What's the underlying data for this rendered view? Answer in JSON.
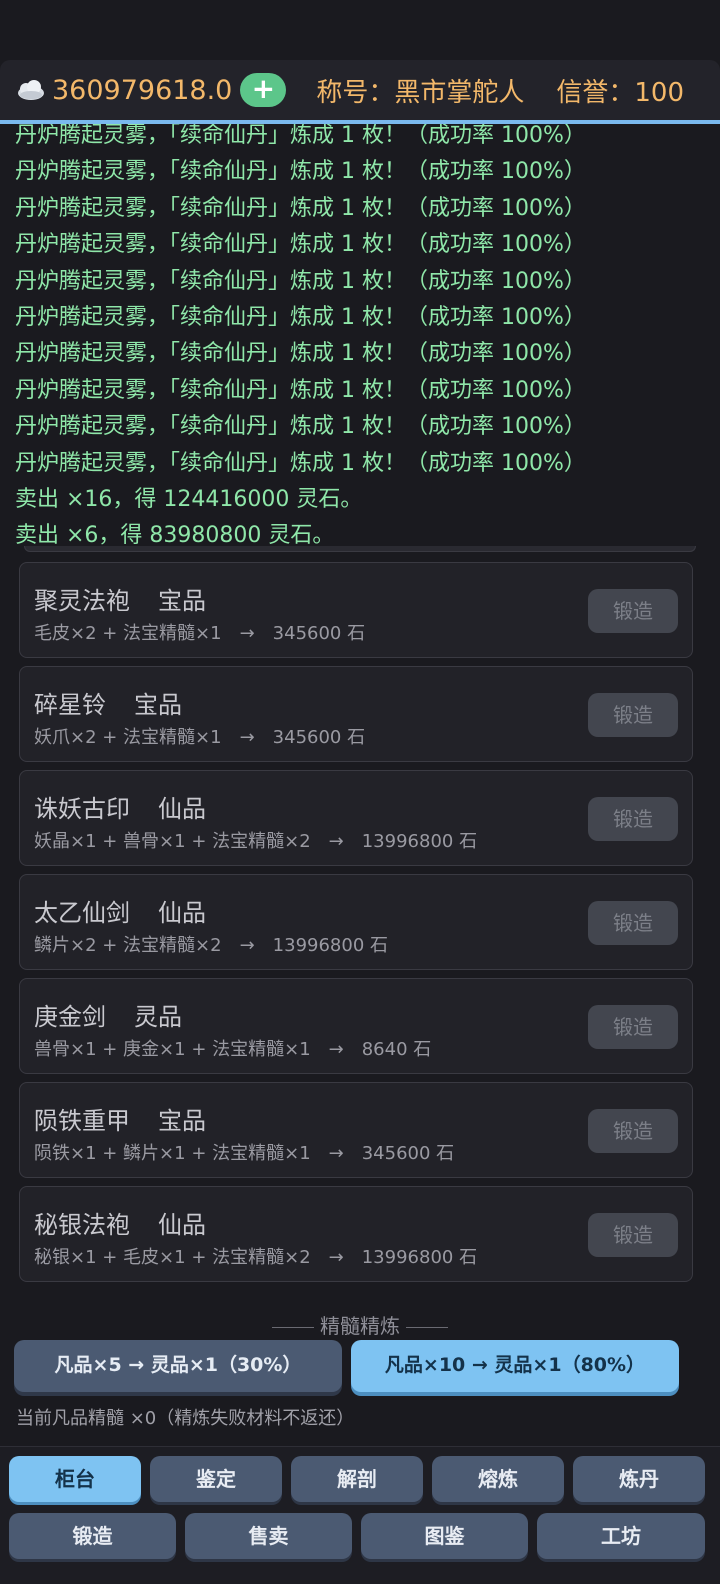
{
  "header": {
    "stones": "360979618.0",
    "plus_label": "+",
    "title": "称号：黑市掌舵人",
    "credit": "信誉：100"
  },
  "log": [
    "丹炉腾起灵雾，「续命仙丹」炼成 1 枚！（成功率 100%）",
    "丹炉腾起灵雾，「续命仙丹」炼成 1 枚！（成功率 100%）",
    "丹炉腾起灵雾，「续命仙丹」炼成 1 枚！（成功率 100%）",
    "丹炉腾起灵雾，「续命仙丹」炼成 1 枚！（成功率 100%）",
    "丹炉腾起灵雾，「续命仙丹」炼成 1 枚！（成功率 100%）",
    "丹炉腾起灵雾，「续命仙丹」炼成 1 枚！（成功率 100%）",
    "丹炉腾起灵雾，「续命仙丹」炼成 1 枚！（成功率 100%）",
    "丹炉腾起灵雾，「续命仙丹」炼成 1 枚！（成功率 100%）",
    "丹炉腾起灵雾，「续命仙丹」炼成 1 枚！（成功率 100%）",
    "丹炉腾起灵雾，「续命仙丹」炼成 1 枚！（成功率 100%）",
    "卖出 ×16，得 124416000 灵石。",
    "卖出 ×6，得 83980800 灵石。"
  ],
  "recipes": [
    {
      "name": "聚灵法袍",
      "grade": "宝品",
      "recipe": "毛皮×2 + 法宝精髓×1　→　345600 石",
      "button": "锻造"
    },
    {
      "name": "碎星铃",
      "grade": "宝品",
      "recipe": "妖爪×2 + 法宝精髓×1　→　345600 石",
      "button": "锻造"
    },
    {
      "name": "诛妖古印",
      "grade": "仙品",
      "recipe": "妖晶×1 + 兽骨×1 + 法宝精髓×2　→　13996800 石",
      "button": "锻造"
    },
    {
      "name": "太乙仙剑",
      "grade": "仙品",
      "recipe": "鳞片×2 + 法宝精髓×2　→　13996800 石",
      "button": "锻造"
    },
    {
      "name": "庚金剑",
      "grade": "灵品",
      "recipe": "兽骨×1 + 庚金×1 + 法宝精髓×1　→　8640 石",
      "button": "锻造"
    },
    {
      "name": "陨铁重甲",
      "grade": "宝品",
      "recipe": "陨铁×1 + 鳞片×1 + 法宝精髓×1　→　345600 石",
      "button": "锻造"
    },
    {
      "name": "秘银法袍",
      "grade": "仙品",
      "recipe": "秘银×1 + 毛皮×1 + 法宝精髓×2　→　13996800 石",
      "button": "锻造"
    }
  ],
  "refine": {
    "title": "精髓精炼",
    "option_a": "凡品×5 → 灵品×1（30%）",
    "option_b": "凡品×10 → 灵品×1（80%）",
    "note": "当前凡品精髓 ×0（精炼失败材料不返还）"
  },
  "nav": {
    "row1": [
      "柜台",
      "鉴定",
      "解剖",
      "熔炼",
      "炼丹"
    ],
    "row2": [
      "锻造",
      "售卖",
      "图鉴",
      "工坊"
    ],
    "active": "柜台"
  }
}
